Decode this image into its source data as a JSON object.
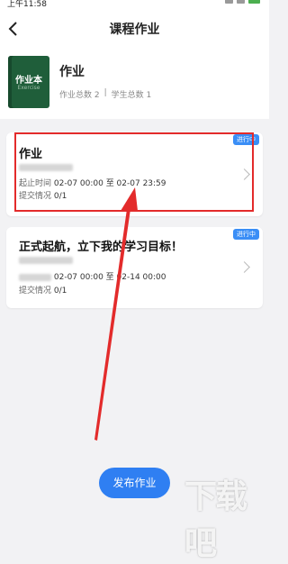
{
  "status_bar": {
    "time": "上午11:58"
  },
  "nav": {
    "title": "课程作业"
  },
  "course": {
    "cover_title": "作业本",
    "cover_subtitle": "Exercise",
    "name": "作业",
    "homework_total": "作业总数 2",
    "student_total": "学生总数 1"
  },
  "assignments": [
    {
      "title": "作业",
      "status": "进行中",
      "time_label": "起止时间",
      "time_value": "02-07 00:00 至 02-07 23:59",
      "submit_label": "提交情况",
      "submit_value": "0/1"
    },
    {
      "title": "正式起航，立下我的学习目标！",
      "status": "进行中",
      "time_label": "起止时间",
      "time_value": "02-07 00:00 至 02-14 00:00",
      "submit_label": "提交情况",
      "submit_value": "0/1"
    }
  ],
  "actions": {
    "publish_label": "发布作业"
  },
  "watermark": {
    "text": "下载吧"
  },
  "colors": {
    "accent": "#2f7ff2",
    "badge": "#3a8ef6",
    "annotation": "#e32b2b",
    "cover": "#1f5e3a"
  }
}
